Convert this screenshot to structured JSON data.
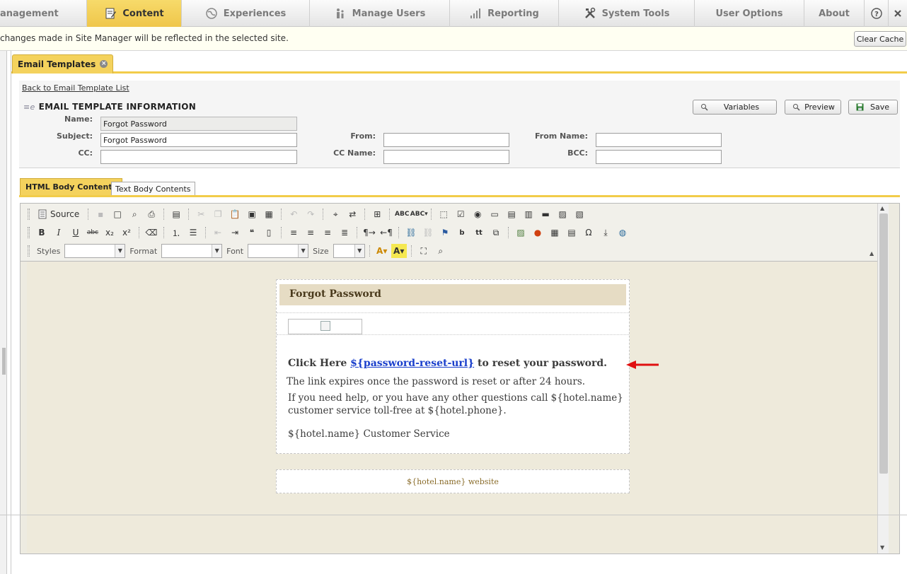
{
  "nav": {
    "tabs": [
      {
        "label": "anagement",
        "icon": "none",
        "active": false
      },
      {
        "label": "Content",
        "icon": "content-icon",
        "active": true
      },
      {
        "label": "Experiences",
        "icon": "globe-icon",
        "active": false
      },
      {
        "label": "Manage Users",
        "icon": "users-icon",
        "active": false
      },
      {
        "label": "Reporting",
        "icon": "bar-chart-icon",
        "active": false
      },
      {
        "label": "System Tools",
        "icon": "tools-icon",
        "active": false
      },
      {
        "label": "User Options",
        "icon": "none",
        "active": false
      },
      {
        "label": "About",
        "icon": "none",
        "active": false
      }
    ],
    "help_icon": "question-icon",
    "close_icon": "close-icon",
    "active_color": "#f2cc4a"
  },
  "infobar": {
    "text": "changes made in Site Manager will be reflected in the selected site.",
    "clear_cache_label": "Clear Cache"
  },
  "doc_tab": {
    "label": "Email Templates"
  },
  "form": {
    "back_link": "Back to Email Template List",
    "section_title": "EMAIL TEMPLATE INFORMATION",
    "buttons": {
      "variables": "Variables",
      "preview": "Preview",
      "save": "Save"
    },
    "fields": {
      "name": {
        "label": "Name:",
        "value": "Forgot Password"
      },
      "subject": {
        "label": "Subject:",
        "value": "Forgot Password"
      },
      "cc": {
        "label": "CC:",
        "value": ""
      },
      "from": {
        "label": "From:",
        "value": ""
      },
      "cc_name": {
        "label": "CC Name:",
        "value": ""
      },
      "from_name": {
        "label": "From Name:",
        "value": ""
      },
      "bcc": {
        "label": "BCC:",
        "value": ""
      }
    }
  },
  "body_tabs": {
    "html": "HTML Body Contents",
    "text": "Text Body Contents"
  },
  "toolbar": {
    "source_label": "Source",
    "styles_label": "Styles",
    "format_label": "Format",
    "font_label": "Font",
    "size_label": "Size"
  },
  "email": {
    "heading": "Forgot Password",
    "click_prefix": "Click Here ",
    "reset_link": "${password-reset-url}",
    "click_suffix": " to reset your password.",
    "expires": "The link expires once the password is reset or after 24 hours.",
    "help": "If you need help, or you have any other questions call ${hotel.name} customer service toll-free at ${hotel.phone}.",
    "signature": "${hotel.name} Customer Service",
    "footer": "${hotel.name} website",
    "link_color": "#1a3fcc",
    "annotation_arrow_color": "#e01010"
  }
}
